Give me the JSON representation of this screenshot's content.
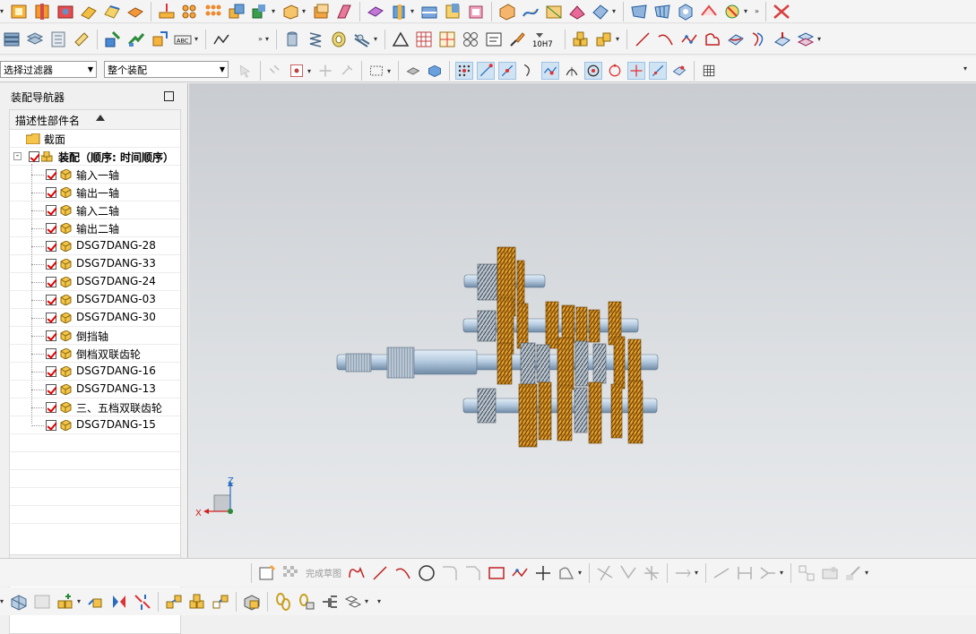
{
  "filters": {
    "selection_filter": "选择过滤器",
    "scope": "整个装配"
  },
  "navigator": {
    "title": "装配导航器",
    "column_header": "描述性部件名",
    "section_node": "截面",
    "root_node": "装配（顺序: 时间顺序）",
    "parts": [
      "输入一轴",
      "输出一轴",
      "输入二轴",
      "输出二轴",
      "DSG7DANG-28",
      "DSG7DANG-33",
      "DSG7DANG-24",
      "DSG7DANG-03",
      "DSG7DANG-30",
      "倒挡轴",
      "倒档双联齿轮",
      "DSG7DANG-16",
      "DSG7DANG-13",
      "三、五档双联齿轮",
      "DSG7DANG-15"
    ]
  },
  "sketch_toolbar": {
    "finish_sketch_label": "完成草图"
  },
  "toolbar2": {
    "tolerance_label": "10H7",
    "abc_label": "ABC"
  },
  "triad": {
    "z_label": "Z",
    "x_label": "X"
  },
  "colors": {
    "gear_orange": "#e8a020",
    "shaft_blue": "#b5cbe0",
    "checkbox_red": "#d00000"
  },
  "icons": [
    "extrude-icon",
    "hole-icon",
    "blend-icon",
    "chamfer-icon",
    "shell-icon",
    "line-icon",
    "arc-icon",
    "circle-icon",
    "rectangle-icon",
    "point-icon",
    "snap-icon"
  ]
}
